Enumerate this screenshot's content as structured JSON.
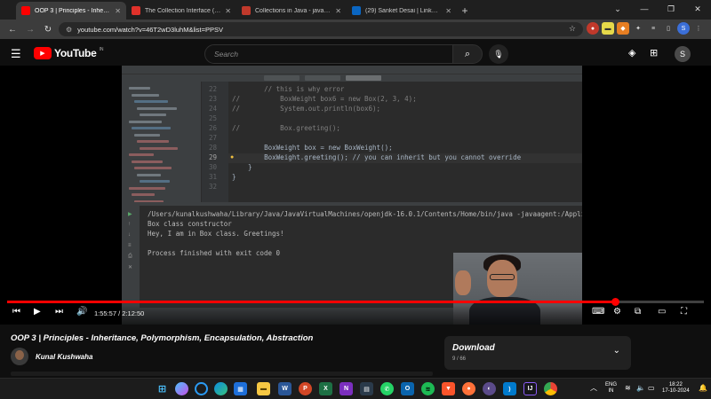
{
  "browser": {
    "tabs": [
      {
        "title": "OOP 3 | Principles - Inheritance",
        "favicon_color": "#ff0000",
        "active": true
      },
      {
        "title": "The Collection Interface (The Jav",
        "favicon_color": "#e0312a",
        "active": false
      },
      {
        "title": "Collections in Java - javatpoint",
        "favicon_color": "#c0392b",
        "active": false
      },
      {
        "title": "(29) Sanket Desai | LinkedIn",
        "favicon_color": "#0a66c2",
        "active": false
      }
    ],
    "new_tab_label": "+",
    "url": "youtube.com/watch?v=46T2wD3luhM&list=PPSV"
  },
  "youtube": {
    "logo_text": "YouTube",
    "region_code": "IN",
    "search_placeholder": "Search",
    "avatar_letter": "S"
  },
  "ide": {
    "line_numbers": [
      "22",
      "23",
      "24",
      "25",
      "26",
      "27",
      "28",
      "29",
      "30",
      "31",
      "32"
    ],
    "code_lines": [
      {
        "text": "        // this is why error",
        "style": "cmt"
      },
      {
        "text": "//          BoxWeight box6 = new Box(2, 3, 4);",
        "style": "cmt"
      },
      {
        "text": "//          System.out.println(box6);",
        "style": "cmt"
      },
      {
        "text": "",
        "style": ""
      },
      {
        "text": "//          Box.greeting();",
        "style": "cmt"
      },
      {
        "text": "",
        "style": ""
      },
      {
        "text": "        BoxWeight box = new BoxWeight();",
        "style": "code"
      },
      {
        "text": "        BoxWeight.greeting(); // you can inherit but you cannot override",
        "style": "code"
      },
      {
        "text": "    }",
        "style": "code"
      },
      {
        "text": "}",
        "style": "code"
      },
      {
        "text": "",
        "style": ""
      }
    ],
    "console_lines": [
      "/Users/kunalkushwaha/Library/Java/JavaVirtualMachines/openjdk-16.0.1/Contents/Home/bin/java -javaagent:/Appli",
      "Box class constructor",
      "Hey, I am in Box class. Greetings!",
      "",
      "Process finished with exit code 0"
    ]
  },
  "player": {
    "current_time": "1:55:57",
    "duration": "2:12:50",
    "time_separator": " / ",
    "progress_fraction": 0.873
  },
  "video": {
    "title": "OOP 3 | Principles - Inheritance, Polymorphism, Encapsulation, Abstraction",
    "channel": "Kunal Kushwaha"
  },
  "download": {
    "title": "Download",
    "subtitle": "9 / 66"
  },
  "taskbar": {
    "language": "ENG",
    "region": "IN",
    "time": "18:22",
    "date": "17-10-2024"
  }
}
